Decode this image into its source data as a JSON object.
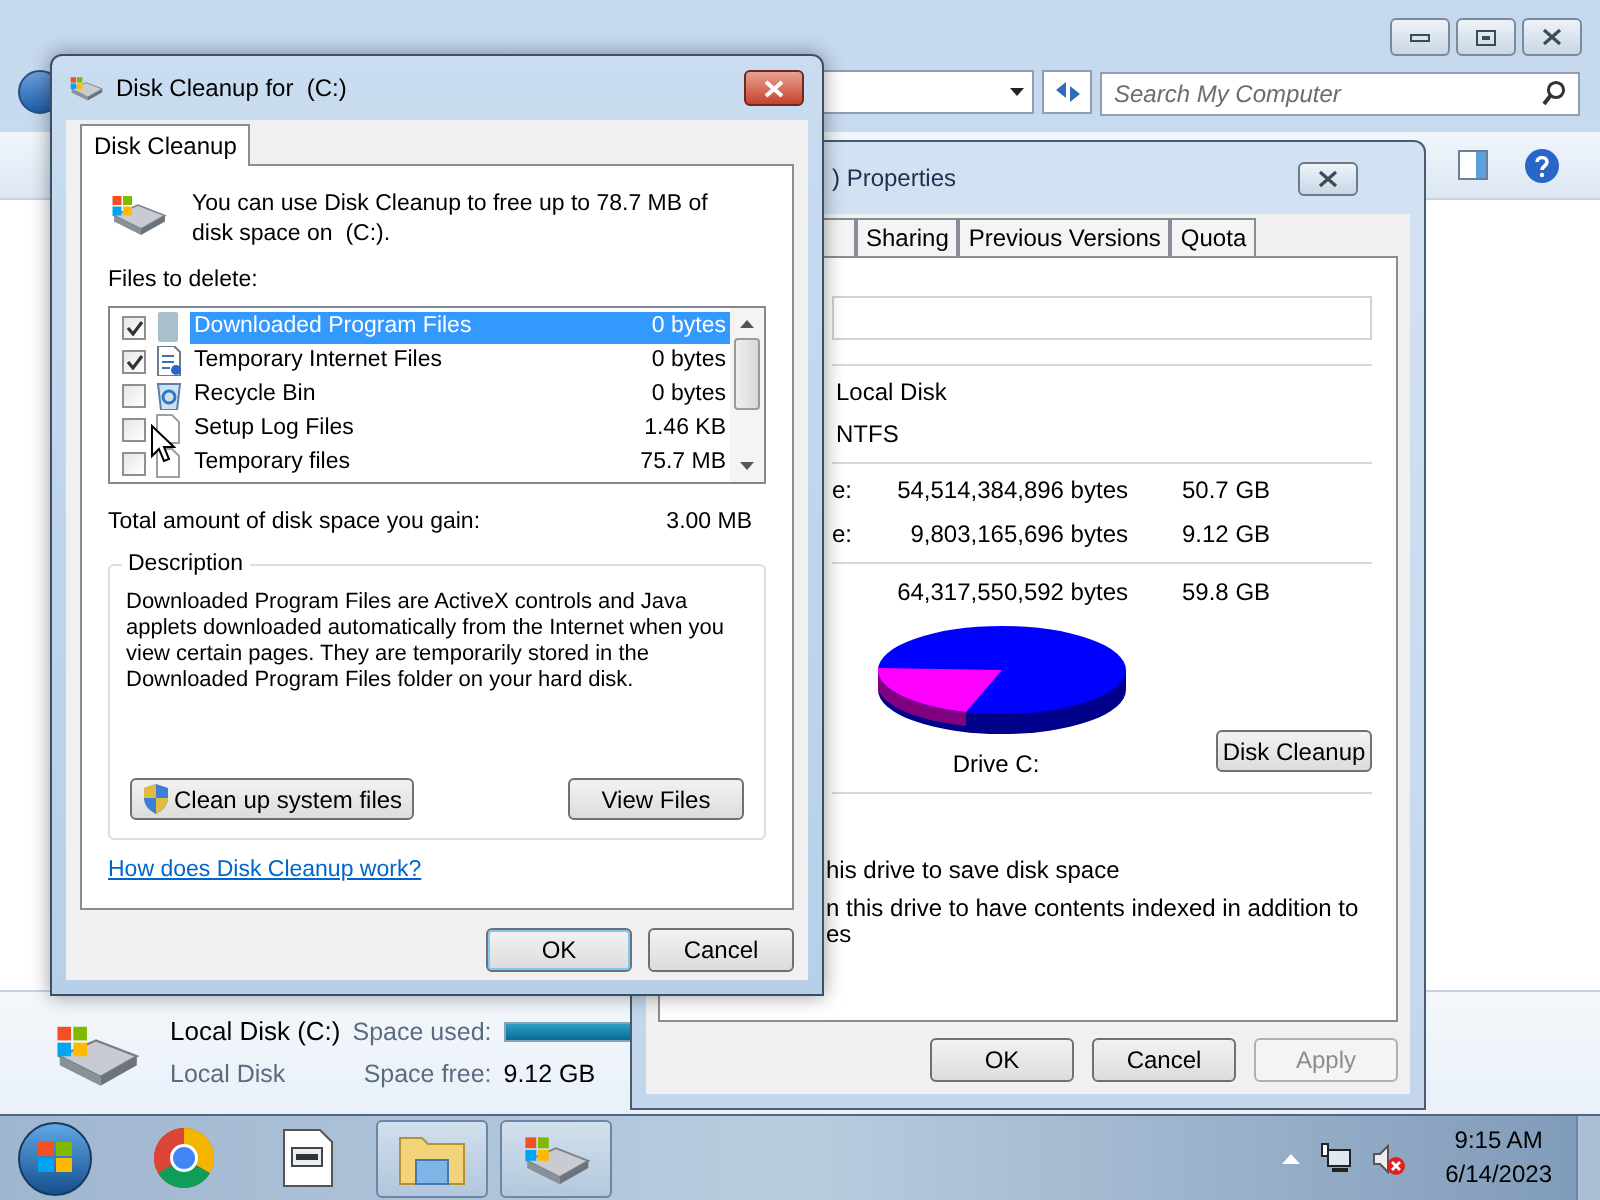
{
  "explorer": {
    "search": {
      "placeholder": "Search My Computer"
    },
    "details": {
      "name": "Local Disk (C:)",
      "type": "Local Disk",
      "space_used": {
        "label": "Space used:",
        "level": 0.85
      },
      "space_free": {
        "label": "Space free:",
        "value": "9.12 GB"
      }
    }
  },
  "properties": {
    "title": ") Properties",
    "tabs": [
      {
        "label": "Sharing"
      },
      {
        "label": "Previous Versions"
      },
      {
        "label": "Quota"
      }
    ],
    "type": "Local Disk",
    "file_system": "NTFS",
    "space_rows": [
      {
        "label": "e:",
        "bytes": "54,514,384,896 bytes",
        "size": "50.7 GB"
      },
      {
        "label": "e:",
        "bytes": "9,803,165,696 bytes",
        "size": "9.12 GB"
      }
    ],
    "capacity": {
      "bytes": "64,317,550,592 bytes",
      "size": "59.8 GB"
    },
    "drive_label": "Drive C:",
    "cleanup_button": "Disk Cleanup",
    "options": [
      {
        "lines": [
          "his drive to save disk space"
        ]
      },
      {
        "lines": [
          "n this drive to have contents indexed in addition to",
          "es"
        ]
      }
    ],
    "buttons": [
      {
        "label": "OK",
        "disabled": false
      },
      {
        "label": "Cancel",
        "disabled": false
      },
      {
        "label": "Apply",
        "disabled": true
      }
    ]
  },
  "cleanup": {
    "title": "Disk Cleanup for  (C:)",
    "tab": "Disk Cleanup",
    "intro": "You can use Disk Cleanup to free up to 78.7 MB of disk space on  (C:).",
    "files_label": "Files to delete:",
    "files": [
      {
        "kind": "program",
        "name": "Downloaded Program Files",
        "size": "0 bytes",
        "checked": true,
        "selected": true
      },
      {
        "kind": "internet",
        "name": "Temporary Internet Files",
        "size": "0 bytes",
        "checked": true,
        "selected": false
      },
      {
        "kind": "recycle",
        "name": "Recycle Bin",
        "size": "0 bytes",
        "checked": false,
        "selected": false
      },
      {
        "kind": "file",
        "name": "Setup Log Files",
        "size": "1.46 KB",
        "checked": false,
        "selected": false
      },
      {
        "kind": "file",
        "name": "Temporary files",
        "size": "75.7 MB",
        "checked": false,
        "selected": false
      }
    ],
    "total_label": "Total amount of disk space you gain:",
    "total": "3.00 MB",
    "description_title": "Description",
    "description": "Downloaded Program Files are ActiveX controls and Java applets downloaded automatically from the Internet when you view certain pages. They are temporarily stored in the Downloaded Program Files folder on your hard disk.",
    "system_button": "Clean up system files",
    "view_button": "View Files",
    "link": "How does Disk Cleanup work?",
    "buttons": [
      {
        "label": "OK",
        "focused": true
      },
      {
        "label": "Cancel",
        "focused": false
      }
    ]
  },
  "taskbar": {
    "apps": [
      {
        "kind": "chrome",
        "open": false
      },
      {
        "kind": "notepad",
        "open": false
      },
      {
        "kind": "explorer",
        "open": true
      },
      {
        "kind": "cleanup",
        "open": true
      }
    ],
    "time": "9:15 AM",
    "date": "6/14/2023"
  }
}
